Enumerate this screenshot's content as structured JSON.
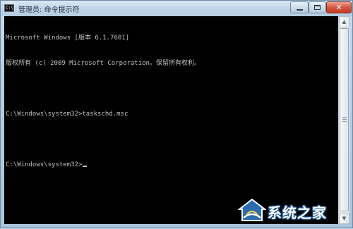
{
  "window": {
    "title": "管理员: 命令提示符",
    "icon": "cmd-icon",
    "icon_text": "C:\\",
    "controls": {
      "minimize_icon": "minimize-icon",
      "maximize_icon": "maximize-icon",
      "close_icon": "close-icon",
      "close_glyph": "✕"
    }
  },
  "console": {
    "lines": [
      "Microsoft Windows [版本 6.1.7601]",
      "版权所有 (c) 2009 Microsoft Corporation。保留所有权利。",
      "",
      "C:\\Windows\\system32>taskschd.msc",
      "",
      "C:\\Windows\\system32>"
    ],
    "foreground": "#c0c0c0",
    "background": "#000000"
  },
  "scrollbar": {
    "up_arrow": "▲",
    "down_arrow": "▼"
  },
  "watermark": {
    "text": "系统之家",
    "logo": "house-logo-icon"
  },
  "colors": {
    "titlebar": "#c2d6e8",
    "close_button": "#d8553f",
    "watermark_blue": "#2b6cb0"
  }
}
